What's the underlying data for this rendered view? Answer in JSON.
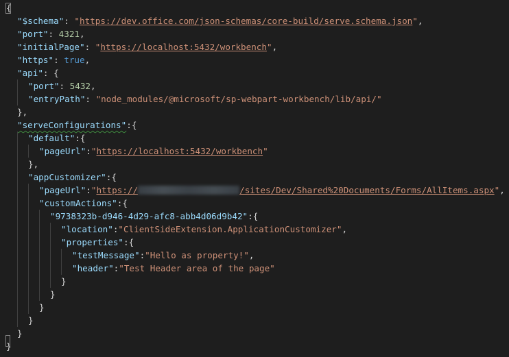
{
  "editor": {
    "lines": [
      {
        "indent": 0,
        "tokens": [
          {
            "t": "pun",
            "v": "{"
          }
        ]
      },
      {
        "indent": 1,
        "tokens": [
          {
            "t": "key",
            "v": "\"$schema\""
          },
          {
            "t": "pun",
            "v": ": "
          },
          {
            "t": "str",
            "v": "\""
          },
          {
            "t": "url",
            "v": "https://dev.office.com/json-schemas/core-build/serve.schema.json"
          },
          {
            "t": "str",
            "v": "\""
          },
          {
            "t": "pun",
            "v": ","
          }
        ]
      },
      {
        "indent": 1,
        "tokens": [
          {
            "t": "key",
            "v": "\"port\""
          },
          {
            "t": "pun",
            "v": ": "
          },
          {
            "t": "num",
            "v": "4321"
          },
          {
            "t": "pun",
            "v": ","
          }
        ]
      },
      {
        "indent": 1,
        "tokens": [
          {
            "t": "key",
            "v": "\"initialPage\""
          },
          {
            "t": "pun",
            "v": ": "
          },
          {
            "t": "str",
            "v": "\""
          },
          {
            "t": "url",
            "v": "https://localhost:5432/workbench"
          },
          {
            "t": "str",
            "v": "\""
          },
          {
            "t": "pun",
            "v": ","
          }
        ]
      },
      {
        "indent": 1,
        "tokens": [
          {
            "t": "key",
            "v": "\"https\""
          },
          {
            "t": "pun",
            "v": ": "
          },
          {
            "t": "kw",
            "v": "true"
          },
          {
            "t": "pun",
            "v": ","
          }
        ]
      },
      {
        "indent": 1,
        "tokens": [
          {
            "t": "key",
            "v": "\"api\""
          },
          {
            "t": "pun",
            "v": ": {"
          }
        ]
      },
      {
        "indent": 2,
        "tokens": [
          {
            "t": "key",
            "v": "\"port\""
          },
          {
            "t": "pun",
            "v": ": "
          },
          {
            "t": "num",
            "v": "5432"
          },
          {
            "t": "pun",
            "v": ","
          }
        ]
      },
      {
        "indent": 2,
        "tokens": [
          {
            "t": "key",
            "v": "\"entryPath\""
          },
          {
            "t": "pun",
            "v": ": "
          },
          {
            "t": "str",
            "v": "\"node_modules/@microsoft/sp-webpart-workbench/lib/api/\""
          }
        ]
      },
      {
        "indent": 1,
        "tokens": [
          {
            "t": "pun",
            "v": "},"
          }
        ]
      },
      {
        "indent": 1,
        "tokens": [
          {
            "t": "key squig",
            "v": "\"serveConfigurations\""
          },
          {
            "t": "pun",
            "v": ":{"
          }
        ]
      },
      {
        "indent": 2,
        "tokens": [
          {
            "t": "key",
            "v": "\"default\""
          },
          {
            "t": "pun",
            "v": ":{"
          }
        ]
      },
      {
        "indent": 3,
        "tokens": [
          {
            "t": "key",
            "v": "\"pageUrl\""
          },
          {
            "t": "pun",
            "v": ":"
          },
          {
            "t": "str",
            "v": "\""
          },
          {
            "t": "url",
            "v": "https://localhost:5432/workbench"
          },
          {
            "t": "str",
            "v": "\""
          }
        ]
      },
      {
        "indent": 2,
        "tokens": [
          {
            "t": "pun",
            "v": "},"
          }
        ]
      },
      {
        "indent": 2,
        "tokens": [
          {
            "t": "key",
            "v": "\"appCustomizer\""
          },
          {
            "t": "pun",
            "v": ":{"
          }
        ]
      },
      {
        "indent": 3,
        "tokens": [
          {
            "t": "key",
            "v": "\"pageUrl\""
          },
          {
            "t": "pun",
            "v": ":"
          },
          {
            "t": "str",
            "v": "\""
          },
          {
            "t": "url",
            "v": "https://"
          },
          {
            "t": "blur",
            "v": ""
          },
          {
            "t": "url",
            "v": "/sites/Dev/Shared%20Documents/Forms/AllItems.aspx"
          },
          {
            "t": "str",
            "v": "\""
          },
          {
            "t": "pun",
            "v": ","
          }
        ]
      },
      {
        "indent": 3,
        "tokens": [
          {
            "t": "key",
            "v": "\"customActions\""
          },
          {
            "t": "pun",
            "v": ":{"
          }
        ]
      },
      {
        "indent": 4,
        "tokens": [
          {
            "t": "key",
            "v": "\"9738323b-d946-4d29-afc8-abb4d06d9b42\""
          },
          {
            "t": "pun",
            "v": ":{"
          }
        ]
      },
      {
        "indent": 5,
        "tokens": [
          {
            "t": "key",
            "v": "\"location\""
          },
          {
            "t": "pun",
            "v": ":"
          },
          {
            "t": "str",
            "v": "\"ClientSideExtension.ApplicationCustomizer\""
          },
          {
            "t": "pun",
            "v": ","
          }
        ]
      },
      {
        "indent": 5,
        "tokens": [
          {
            "t": "key",
            "v": "\"properties\""
          },
          {
            "t": "pun",
            "v": ":{"
          }
        ]
      },
      {
        "indent": 6,
        "tokens": [
          {
            "t": "key",
            "v": "\"testMessage\""
          },
          {
            "t": "pun",
            "v": ":"
          },
          {
            "t": "str",
            "v": "\"Hello as property!\""
          },
          {
            "t": "pun",
            "v": ","
          }
        ]
      },
      {
        "indent": 6,
        "tokens": [
          {
            "t": "key",
            "v": "\"header\""
          },
          {
            "t": "pun",
            "v": ":"
          },
          {
            "t": "str",
            "v": "\"Test Header area of the page\""
          }
        ]
      },
      {
        "indent": 5,
        "tokens": [
          {
            "t": "pun",
            "v": "}"
          }
        ]
      },
      {
        "indent": 4,
        "tokens": [
          {
            "t": "pun",
            "v": "}"
          }
        ]
      },
      {
        "indent": 3,
        "tokens": [
          {
            "t": "pun",
            "v": "}"
          }
        ]
      },
      {
        "indent": 2,
        "tokens": [
          {
            "t": "pun",
            "v": "}"
          }
        ]
      },
      {
        "indent": 1,
        "tokens": [
          {
            "t": "pun",
            "v": "}"
          }
        ]
      },
      {
        "indent": 0,
        "tokens": [
          {
            "t": "pun",
            "v": "}"
          }
        ]
      }
    ]
  },
  "colors": {
    "background": "#1e1e1e",
    "key": "#9cdcfe",
    "string": "#ce9178",
    "number": "#b5cea8",
    "keyword": "#569cd6",
    "punctuation": "#d4d4d4"
  }
}
